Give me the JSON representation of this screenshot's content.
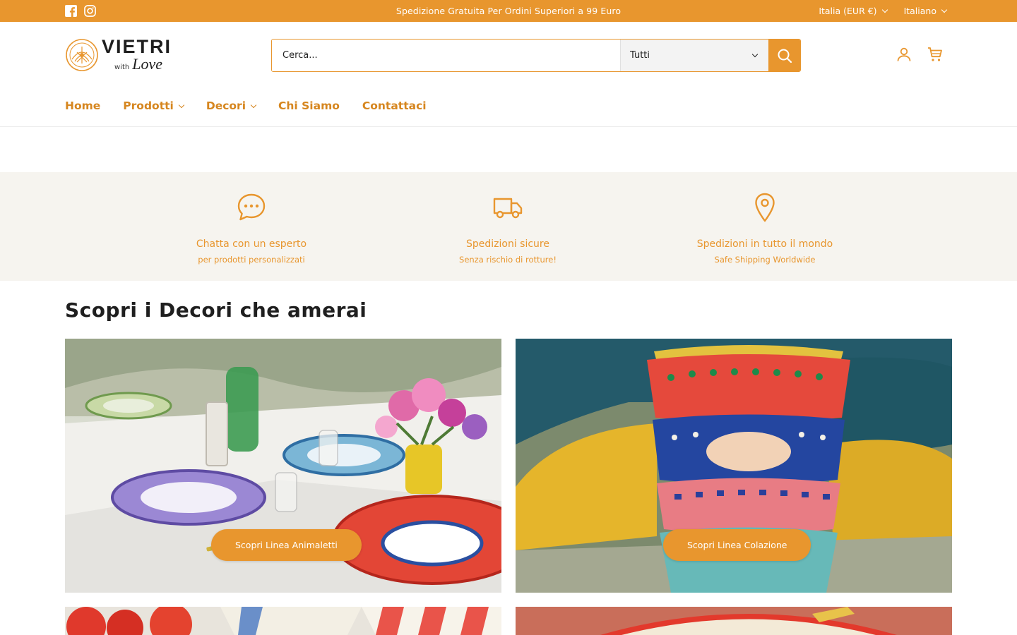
{
  "topbar": {
    "announcement": "Spedizione Gratuita Per Ordini Superiori a 99 Euro",
    "currency": "Italia (EUR €)",
    "language": "Italiano",
    "social": [
      "facebook-icon",
      "instagram-icon"
    ],
    "bg_color": "#e8962e"
  },
  "header": {
    "logo": {
      "name": "VIETRI",
      "with": "with",
      "love": "Love"
    },
    "search": {
      "placeholder": "Cerca...",
      "category_selected": "Tutti"
    },
    "icons": [
      "account-icon",
      "cart-icon"
    ]
  },
  "nav": {
    "items": [
      {
        "label": "Home",
        "dropdown": false
      },
      {
        "label": "Prodotti",
        "dropdown": true
      },
      {
        "label": "Decori",
        "dropdown": true
      },
      {
        "label": "Chi Siamo",
        "dropdown": false
      },
      {
        "label": "Contattaci",
        "dropdown": false
      }
    ]
  },
  "features": [
    {
      "icon": "chat-bubble-icon",
      "title": "Chatta con un esperto",
      "subtitle": "per prodotti personalizzati"
    },
    {
      "icon": "truck-icon",
      "title": "Spedizioni sicure",
      "subtitle": "Senza rischio di rotture!"
    },
    {
      "icon": "map-pin-icon",
      "title": "Spedizioni in tutto il mondo",
      "subtitle": "Safe Shipping Worldwide"
    }
  ],
  "collections": {
    "title": "Scopri i Decori che amerai",
    "tiles": [
      {
        "cta": "Scopri Linea Animaletti"
      },
      {
        "cta": "Scopri Linea Colazione"
      }
    ]
  },
  "colors": {
    "accent": "#e8962e",
    "nav_text": "#d6861f",
    "features_bg": "#f6f4ef"
  }
}
